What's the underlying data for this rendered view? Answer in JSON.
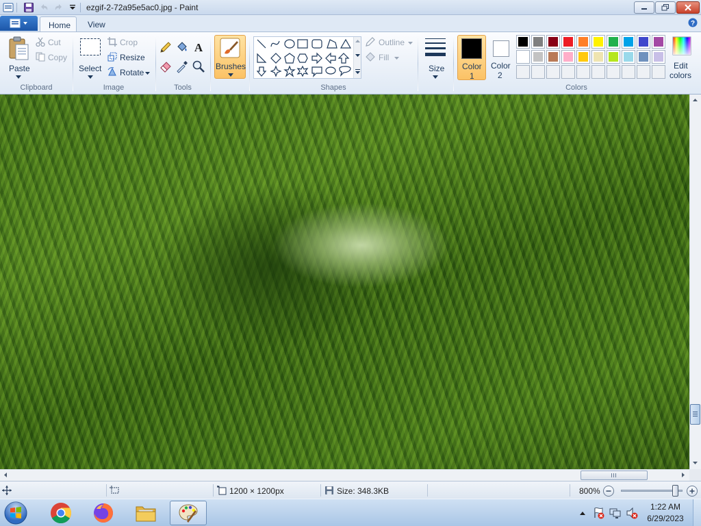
{
  "window": {
    "title": "ezgif-2-72a95e5ac0.jpg - Paint"
  },
  "tabs": {
    "home": "Home",
    "view": "View"
  },
  "ribbon": {
    "clipboard": {
      "paste": "Paste",
      "cut": "Cut",
      "copy": "Copy",
      "label": "Clipboard"
    },
    "image": {
      "select": "Select",
      "crop": "Crop",
      "resize": "Resize",
      "rotate": "Rotate",
      "label": "Image"
    },
    "tools": {
      "label": "Tools"
    },
    "brushes": {
      "label": "Brushes"
    },
    "shapes": {
      "outline": "Outline",
      "fill": "Fill",
      "label": "Shapes"
    },
    "size": {
      "label": "Size"
    },
    "color1": {
      "line1": "Color",
      "line2": "1",
      "swatch": "#000000"
    },
    "color2": {
      "line1": "Color",
      "line2": "2",
      "swatch": "#ffffff"
    },
    "colors": {
      "label": "Colors",
      "row1": [
        "#000000",
        "#7f7f7f",
        "#880015",
        "#ed1c24",
        "#ff7f27",
        "#fff200",
        "#22b14c",
        "#00a2e8",
        "#3f48cc",
        "#a349a4"
      ],
      "row2": [
        "#ffffff",
        "#c3c3c3",
        "#b97a57",
        "#ffaec9",
        "#ffc90e",
        "#efe4b0",
        "#b5e61d",
        "#99d9ea",
        "#7092be",
        "#c8bfe7"
      ]
    },
    "edit_colors": {
      "line1": "Edit",
      "line2": "colors"
    }
  },
  "statusbar": {
    "dimensions": "1200 × 1200px",
    "size": "Size: 348.3KB",
    "zoom": "800%",
    "zoom_fraction": 0.93
  },
  "taskbar": {
    "time": "1:22 AM",
    "date": "6/29/2023"
  }
}
